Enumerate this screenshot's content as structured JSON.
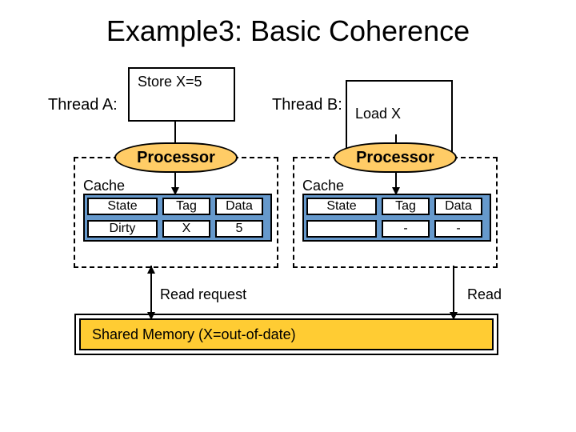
{
  "title": "Example3: Basic Coherence",
  "threadA": {
    "label": "Thread A:",
    "code": "Store X=5"
  },
  "threadB": {
    "label": "Thread B:",
    "code": "Load X"
  },
  "processor_label": "Processor",
  "cache_label": "Cache",
  "headers": {
    "state": "State",
    "tag": "Tag",
    "data": "Data"
  },
  "cacheA": {
    "state": "Dirty",
    "tag": "X",
    "data": "5"
  },
  "cacheB": {
    "state": "",
    "tag": "-",
    "data": "-"
  },
  "reqA": "Read request",
  "reqB": "Read",
  "memory": "Shared Memory (X=out-of-date)",
  "chart_data": {
    "type": "table",
    "title": "Cache coherence state snapshot",
    "tables": [
      {
        "name": "Thread A cache",
        "columns": [
          "State",
          "Tag",
          "Data"
        ],
        "rows": [
          [
            "Dirty",
            "X",
            "5"
          ]
        ]
      },
      {
        "name": "Thread B cache",
        "columns": [
          "State",
          "Tag",
          "Data"
        ],
        "rows": [
          [
            "",
            "-",
            "-"
          ]
        ]
      }
    ],
    "shared_memory": "X = out-of-date",
    "operations": {
      "Thread A": "Store X=5",
      "Thread B": "Load X"
    }
  }
}
